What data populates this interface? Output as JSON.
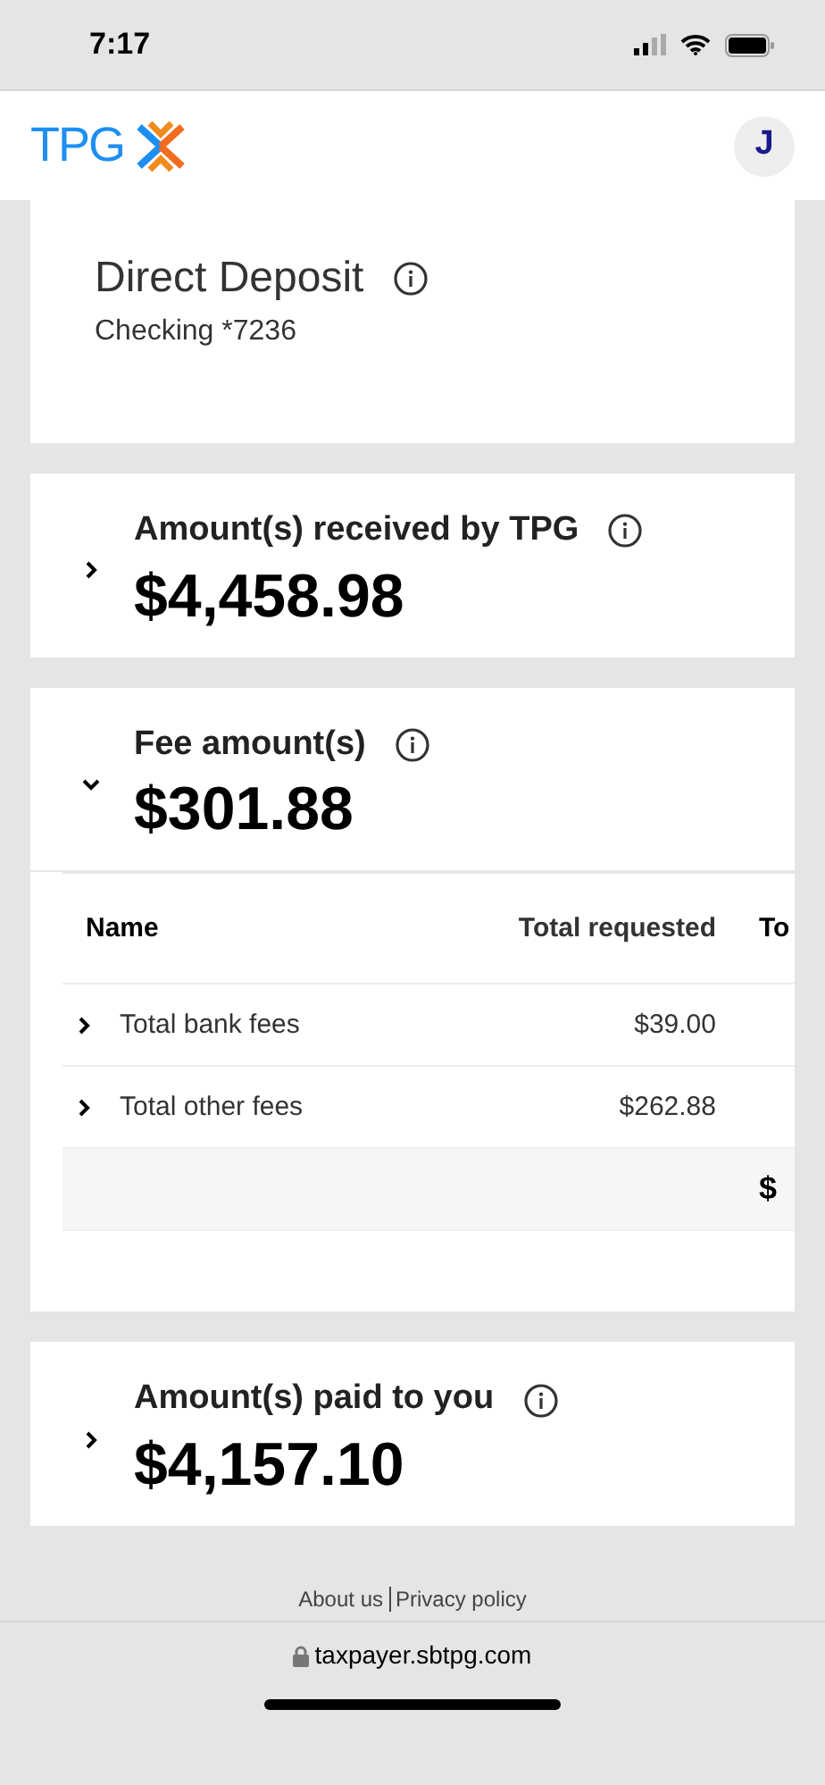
{
  "status_bar": {
    "time": "7:17"
  },
  "header": {
    "logo": "TPG",
    "avatar": "J"
  },
  "deposit": {
    "title": "Direct Deposit",
    "account": "Checking *7236"
  },
  "sections": [
    {
      "title": "Amount(s) received by TPG",
      "amount": "$4,458.98",
      "expanded": false
    },
    {
      "title": "Fee amount(s)",
      "amount": "$301.88",
      "expanded": true,
      "table": {
        "columns": [
          "Name",
          "Total requested",
          "To"
        ],
        "rows": [
          {
            "expanded": false,
            "name": "Total bank fees",
            "requested": "$39.00"
          },
          {
            "expanded": false,
            "name": "Total other fees",
            "requested": "$262.88"
          }
        ],
        "total_row": {
          "column_3": "$"
        }
      }
    },
    {
      "title": "Amount(s) paid to you",
      "amount": "$4,157.10",
      "expanded": false
    }
  ],
  "footer": {
    "links": [
      "About us",
      "Privacy policy"
    ]
  },
  "browser": {
    "url": "taxpayer.sbtpg.com"
  }
}
